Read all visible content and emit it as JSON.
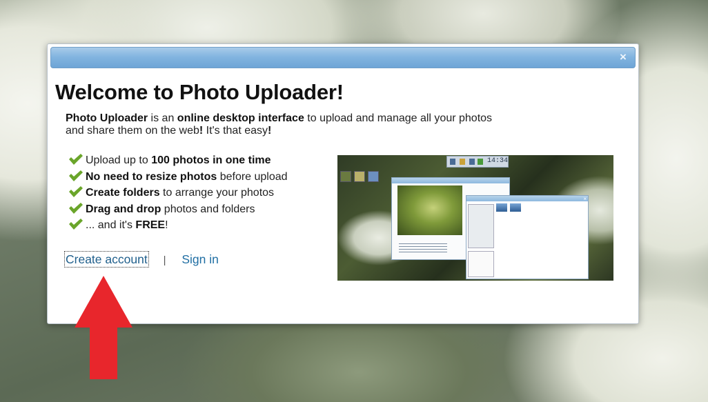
{
  "dialog": {
    "close_label": "×",
    "title": "Welcome to Photo Uploader!",
    "intro": [
      {
        "text": "Photo Uploader",
        "bold": true
      },
      {
        "text": " is an ",
        "bold": false
      },
      {
        "text": "online desktop interface",
        "bold": true
      },
      {
        "text": " to upload and manage all your photos and share them on the web",
        "bold": false
      },
      {
        "text": "!",
        "bold": true
      },
      {
        "text": " It's that easy",
        "bold": false
      },
      {
        "text": "!",
        "bold": true
      }
    ],
    "features": [
      [
        {
          "text": "Upload up to ",
          "bold": false
        },
        {
          "text": "100 photos in one time",
          "bold": true
        }
      ],
      [
        {
          "text": "No need to resize photos",
          "bold": true
        },
        {
          "text": " before upload",
          "bold": false
        }
      ],
      [
        {
          "text": "Create folders",
          "bold": true
        },
        {
          "text": " to arrange your photos",
          "bold": false
        }
      ],
      [
        {
          "text": "Drag and drop",
          "bold": true
        },
        {
          "text": " photos and folders",
          "bold": false
        }
      ],
      [
        {
          "text": "... and it's ",
          "bold": false
        },
        {
          "text": "FREE",
          "bold": true
        },
        {
          "text": "!",
          "bold": false
        }
      ]
    ],
    "actions": {
      "create_label": "Create account",
      "separator": "|",
      "signin_label": "Sign in"
    },
    "preview": {
      "clock": "14:34"
    }
  },
  "colors": {
    "titlebar": "#83b5e0",
    "link": "#1f6ea3",
    "check": "#6aa52a",
    "arrow": "#e8262c"
  }
}
